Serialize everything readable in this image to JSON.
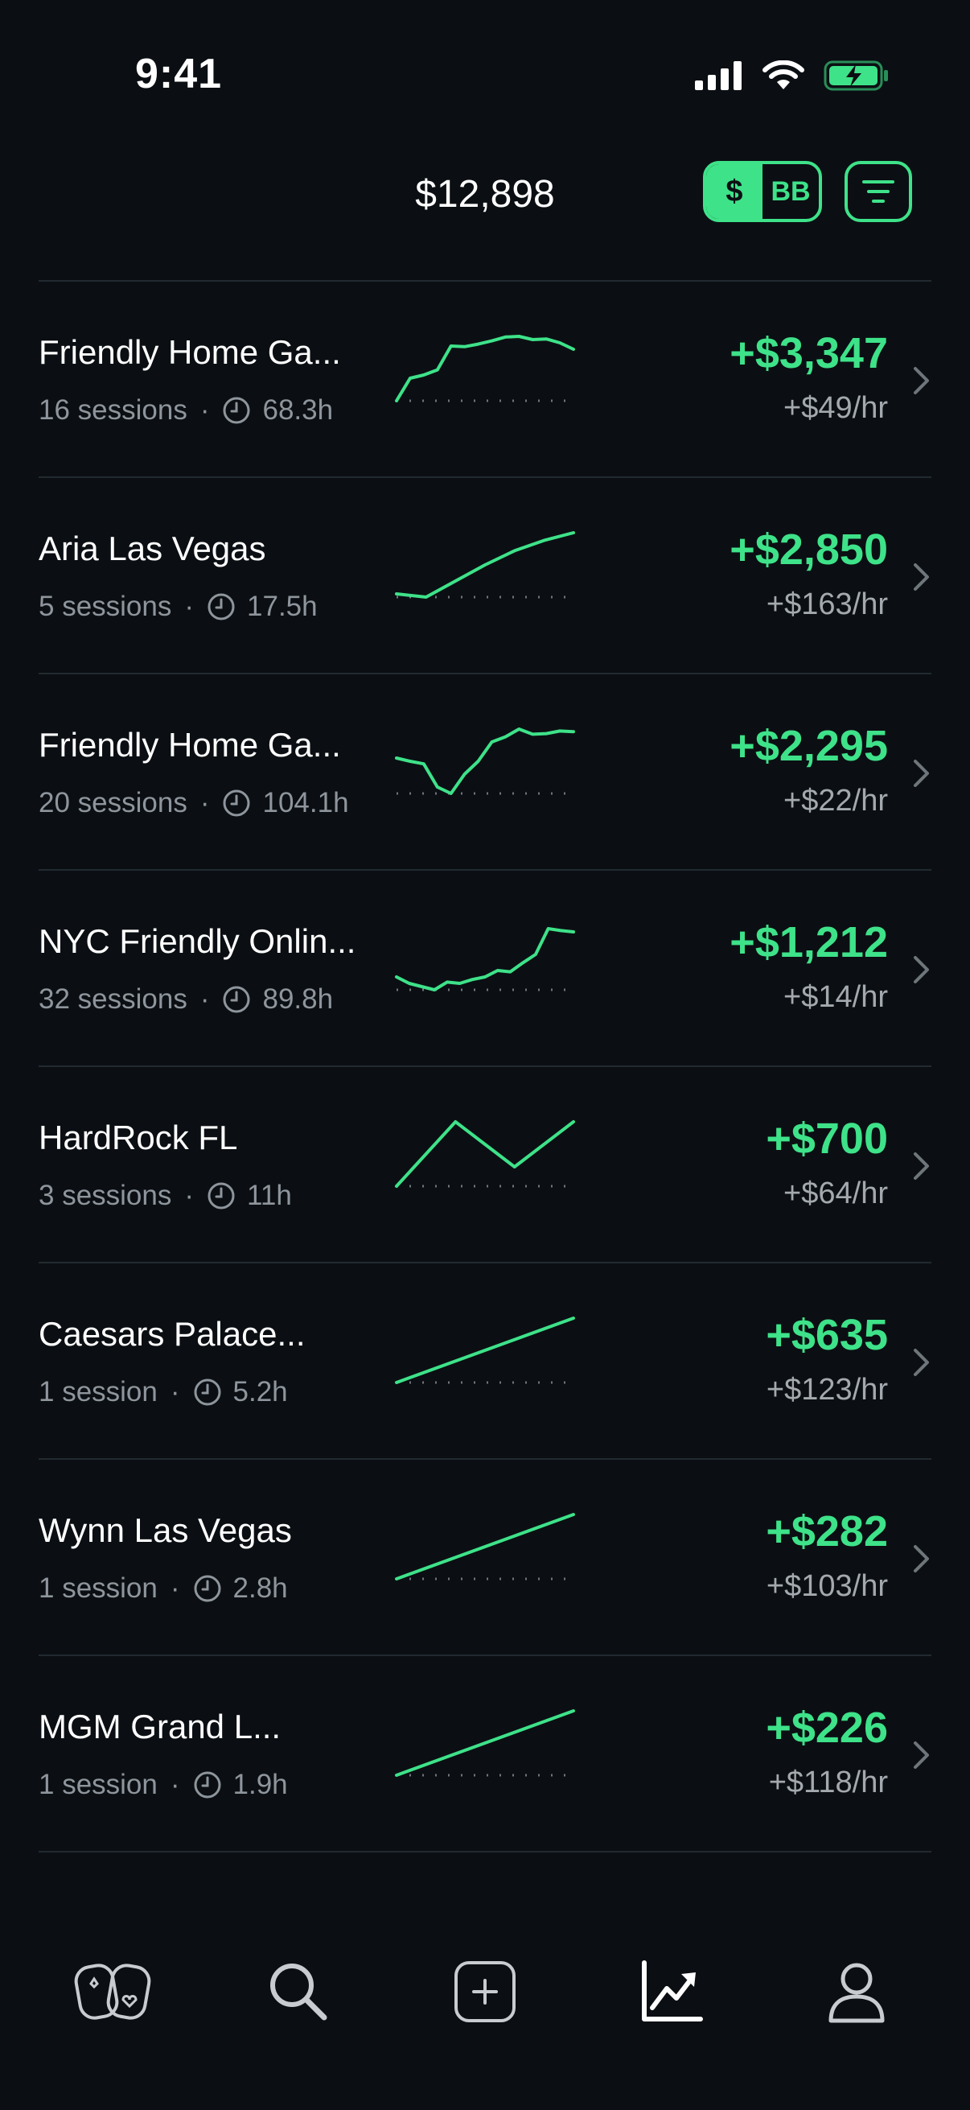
{
  "status": {
    "time": "9:41"
  },
  "header": {
    "total": "$12,898",
    "toggle_active": "$",
    "toggle_inactive": "BB"
  },
  "colors": {
    "accent": "#3ee289",
    "background": "#0b0f13",
    "muted": "#8e959c"
  },
  "rows": [
    {
      "name": "Friendly Home Ga...",
      "sessions": "16 sessions",
      "hours": "68.3h",
      "profit": "+$3,347",
      "rate": "+$49/hr",
      "trend": [
        0,
        0.35,
        0.4,
        0.48,
        0.85,
        0.84,
        0.88,
        0.93,
        0.99,
        1.0,
        0.95,
        0.96,
        0.9,
        0.8
      ]
    },
    {
      "name": "Aria Las Vegas",
      "sessions": "5 sessions",
      "hours": "17.5h",
      "profit": "+$2,850",
      "rate": "+$163/hr",
      "trend": [
        0.05,
        0.0,
        0.25,
        0.5,
        0.72,
        0.88,
        1.0
      ]
    },
    {
      "name": "Friendly Home Ga...",
      "sessions": "20 sessions",
      "hours": "104.1h",
      "profit": "+$2,295",
      "rate": "+$22/hr",
      "trend": [
        0.55,
        0.5,
        0.46,
        0.1,
        0.0,
        0.3,
        0.5,
        0.8,
        0.88,
        1.0,
        0.92,
        0.93,
        0.97,
        0.96
      ]
    },
    {
      "name": "NYC Friendly Onlin...",
      "sessions": "32 sessions",
      "hours": "89.8h",
      "profit": "+$1,212",
      "rate": "+$14/hr",
      "trend": [
        0.2,
        0.1,
        0.05,
        0.0,
        0.12,
        0.1,
        0.16,
        0.2,
        0.3,
        0.28,
        0.42,
        0.55,
        0.95,
        0.92,
        0.9
      ]
    },
    {
      "name": "HardRock FL",
      "sessions": "3 sessions",
      "hours": "11h",
      "profit": "+$700",
      "rate": "+$64/hr",
      "trend": [
        0,
        1.0,
        0.3,
        1.0
      ]
    },
    {
      "name": "Caesars Palace...",
      "sessions": "1 session",
      "hours": "5.2h",
      "profit": "+$635",
      "rate": "+$123/hr",
      "trend": [
        0,
        1.0
      ]
    },
    {
      "name": "Wynn Las Vegas",
      "sessions": "1 session",
      "hours": "2.8h",
      "profit": "+$282",
      "rate": "+$103/hr",
      "trend": [
        0,
        1.0
      ]
    },
    {
      "name": "MGM Grand L...",
      "sessions": "1 session",
      "hours": "1.9h",
      "profit": "+$226",
      "rate": "+$118/hr",
      "trend": [
        0,
        1.0
      ]
    }
  ],
  "tabbar": {
    "items": [
      "cards-icon",
      "search-icon",
      "add-icon",
      "chart-icon",
      "profile-icon"
    ],
    "active": "chart-icon"
  }
}
